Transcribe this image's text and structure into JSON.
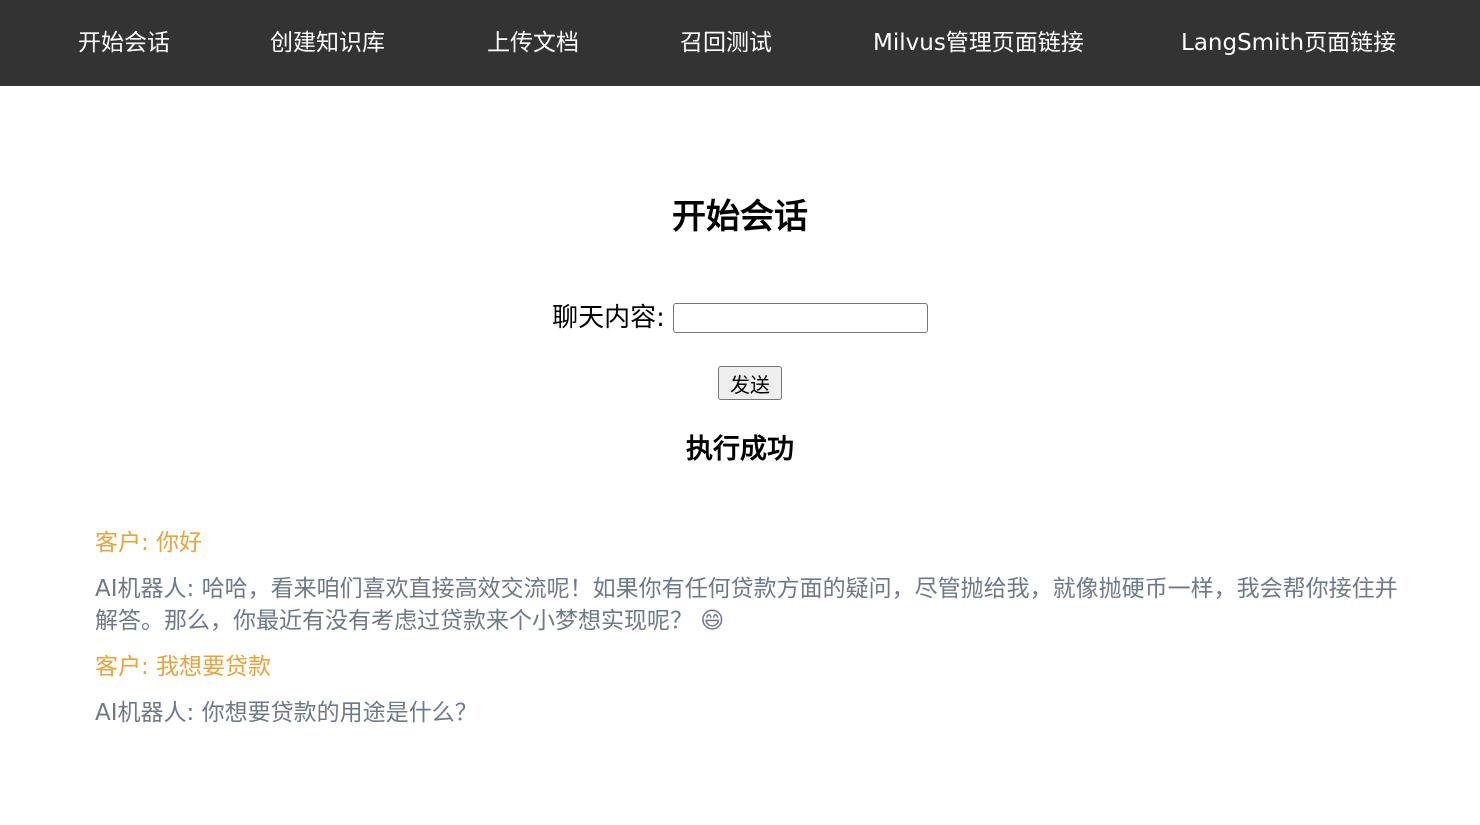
{
  "nav": {
    "items": [
      {
        "label": "开始会话"
      },
      {
        "label": "创建知识库"
      },
      {
        "label": "上传文档"
      },
      {
        "label": "召回测试"
      },
      {
        "label": "Milvus管理页面链接"
      },
      {
        "label": "LangSmith页面链接"
      }
    ]
  },
  "page": {
    "title": "开始会话"
  },
  "chat": {
    "label": "聊天内容:",
    "input_value": "",
    "send_label": "发送",
    "status": "执行成功"
  },
  "messages": [
    {
      "role": "customer",
      "text": "客户: 你好"
    },
    {
      "role": "bot",
      "text": "AI机器人: 哈哈，看来咱们喜欢直接高效交流呢！如果你有任何贷款方面的疑问，尽管抛给我，就像抛硬币一样，我会帮你接住并解答。那么，你最近有没有考虑过贷款来个小梦想实现呢？ 😄"
    },
    {
      "role": "customer",
      "text": "客户: 我想要贷款"
    },
    {
      "role": "bot",
      "text": "AI机器人: 你想要贷款的用途是什么？"
    }
  ],
  "colors": {
    "navbar_bg": "#333333",
    "customer_text": "#e8a33c",
    "bot_text": "#6e7a89"
  }
}
